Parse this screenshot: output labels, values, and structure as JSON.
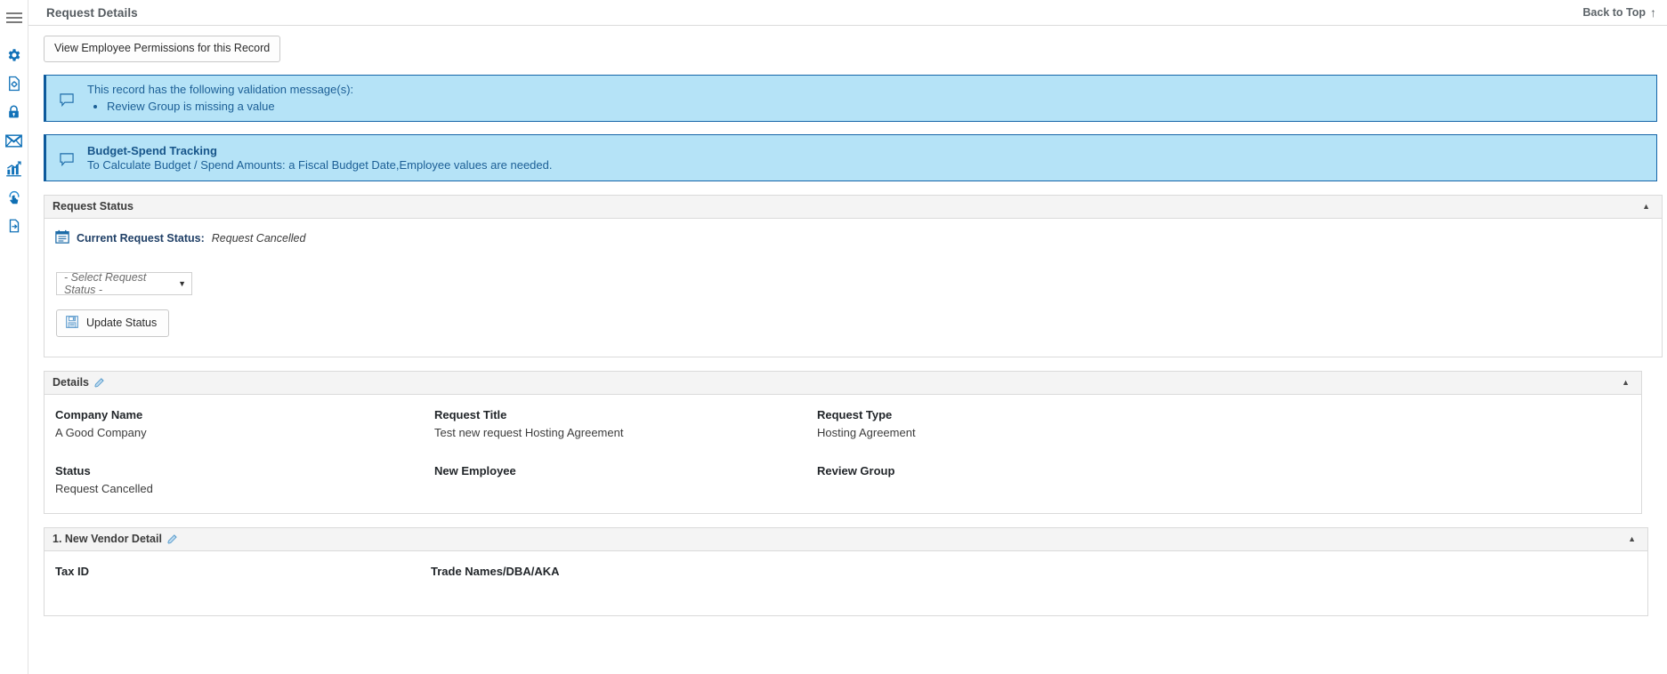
{
  "rail": {
    "items": [
      {
        "name": "menu-icon",
        "label": "Menu"
      },
      {
        "name": "gear-icon",
        "label": "Settings"
      },
      {
        "name": "document-settings-icon",
        "label": "Document Setup"
      },
      {
        "name": "lock-icon",
        "label": "Security"
      },
      {
        "name": "envelope-icon",
        "label": "Messages"
      },
      {
        "name": "chart-icon",
        "label": "Reports"
      },
      {
        "name": "click-hand-icon",
        "label": "Actions"
      },
      {
        "name": "file-import-icon",
        "label": "Import"
      }
    ]
  },
  "header": {
    "title": "Request Details",
    "back_to_top": "Back to Top",
    "back_to_top_arrow": "↑"
  },
  "toolbar": {
    "view_permissions_label": "View Employee Permissions for this Record"
  },
  "alerts": [
    {
      "icon": "comment-icon",
      "title": "",
      "text": "This record has the following validation message(s):",
      "bullets": [
        "Review Group is missing a value"
      ]
    },
    {
      "icon": "comment-icon",
      "title": "Budget-Spend Tracking",
      "text": "To Calculate Budget / Spend Amounts: a Fiscal Budget Date,Employee values are needed.",
      "bullets": []
    }
  ],
  "request_status": {
    "panel_title": "Request Status",
    "collapse_glyph": "▲",
    "current_label": "Current Request Status:",
    "current_value": "Request Cancelled",
    "select_value": "- Select Request Status -",
    "select_caret": "▼",
    "update_button": "Update Status"
  },
  "details": {
    "panel_title": "Details",
    "collapse_glyph": "▲",
    "fields": [
      {
        "label": "Company Name",
        "value": "A Good Company"
      },
      {
        "label": "Request Title",
        "value": "Test new request Hosting Agreement"
      },
      {
        "label": "Request Type",
        "value": "Hosting Agreement"
      },
      {
        "label": "Status",
        "value": "Request Cancelled"
      },
      {
        "label": "New Employee",
        "value": ""
      },
      {
        "label": "Review Group",
        "value": ""
      }
    ]
  },
  "vendor": {
    "panel_title": "1. New Vendor Detail",
    "collapse_glyph": "▲",
    "fields": [
      {
        "label": "Tax ID",
        "value": ""
      },
      {
        "label": "Trade Names/DBA/AKA",
        "value": ""
      }
    ]
  },
  "colors": {
    "accent_blue": "#1071b8",
    "alert_bg": "#b5e3f7",
    "alert_border": "#0d5a9c",
    "alert_text": "#1c5f96",
    "panel_head_bg": "#f4f4f4"
  }
}
